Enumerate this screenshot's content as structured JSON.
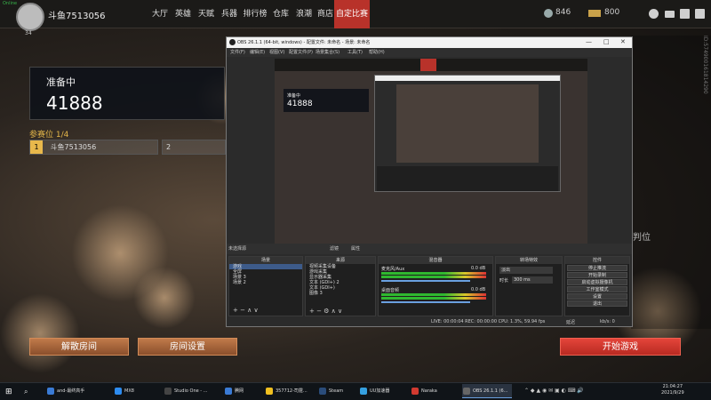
{
  "game": {
    "online_status": "Online",
    "username": "斗鱼7513056",
    "level": "34",
    "nav": [
      "大厅",
      "英雄",
      "天赋",
      "兵器",
      "排行榜",
      "仓库",
      "浪潮",
      "商店",
      "自定比赛"
    ],
    "currency1": "846",
    "currency2": "800",
    "prep_label": "准备中",
    "room_id": "41888",
    "slots_label": "参赛位 1/4",
    "slot1_num": "1",
    "slot1_name": "斗鱼7513056",
    "slot2_num": "2",
    "right_text": "判位",
    "vertical_text": "ID:574900161814290",
    "btn_dissolve": "解散房间",
    "btn_settings": "房间设置",
    "btn_start": "开始游戏"
  },
  "obs": {
    "title": "OBS 26.1.1 (64-bit, windows) - 配置文件: 未命名 - 场景: 未命名",
    "menu": [
      "文件(F)",
      "编辑(E)",
      "视图(V)",
      "配置文件(P)",
      "场景集合(S)",
      "工具(T)",
      "帮助(H)"
    ],
    "no_source": "未选择源",
    "filter": "滤镜",
    "properties": "属性",
    "scenes_header": "场景",
    "scenes": [
      "游戏",
      "全屏",
      "场景 3",
      "场景 2"
    ],
    "sources_header": "来源",
    "sources": [
      "视频采集设备",
      "游戏采集",
      "显示器采集",
      "文本 (GDI+) 2",
      "文本 (GDI+)",
      "图像 3"
    ],
    "mixer_header": "混音器",
    "mixer_tracks": [
      {
        "name": "麦克风/Aux",
        "db": "0.0 dB"
      },
      {
        "name": "桌面音频",
        "db": "0.0 dB"
      }
    ],
    "transitions_header": "转场特效",
    "transition": "淡出",
    "duration_label": "时长",
    "duration": "300 ms",
    "controls_header": "控件",
    "controls": [
      "停止推流",
      "开始录制",
      "启动虚拟摄像机",
      "工作室模式",
      "设置",
      "退出"
    ],
    "status": "LIVE: 00:00:04   REC: 00:00:00   CPU: 1.3%, 59.94 fps",
    "delay": "延迟",
    "kbps": "kb/s: 0"
  },
  "taskbar": {
    "items": [
      "and-最终高手",
      "MX8",
      "Studio One - ...",
      "腾网",
      "357712-司霆...",
      "Steam",
      "UU加速器",
      "Naraka",
      "OBS 26.1.1 (6..."
    ],
    "time": "21:04:27",
    "date": "2021/9/29"
  },
  "colors": {
    "accent_red": "#b8322a",
    "gold": "#e3b64a",
    "start_red": "#e4453a"
  }
}
